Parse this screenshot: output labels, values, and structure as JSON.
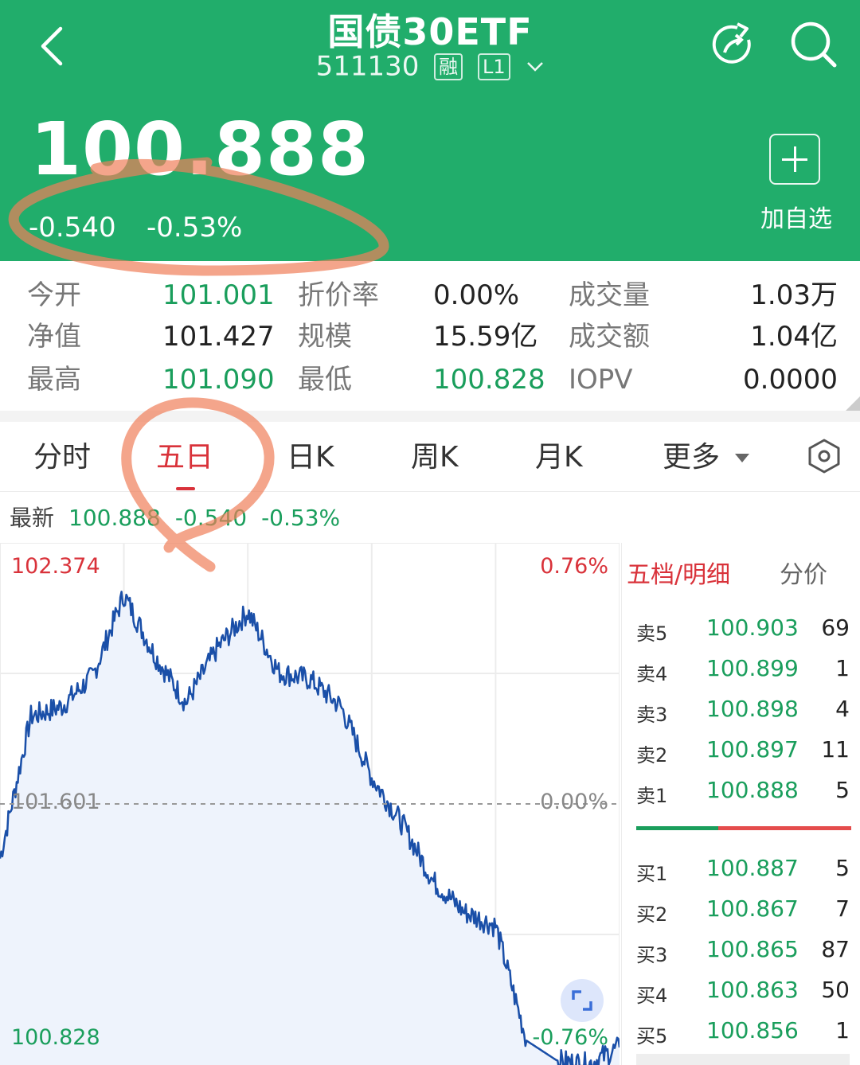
{
  "header": {
    "title": "国债30ETF",
    "code": "511130",
    "tag_margin": "融",
    "tag_level": "L1",
    "price": "100.888",
    "change": "-0.540",
    "change_pct": "-0.53%",
    "add_label": "加自选",
    "bg_color": "#21ad6b"
  },
  "stats": [
    {
      "label": "今开",
      "value": "101.001",
      "color": "green"
    },
    {
      "label": "折价率",
      "value": "0.00%",
      "color": "dark"
    },
    {
      "label": "成交量",
      "value": "1.03万",
      "color": "dark"
    },
    {
      "label": "净值",
      "value": "101.427",
      "color": "dark"
    },
    {
      "label": "规模",
      "value": "15.59亿",
      "color": "dark"
    },
    {
      "label": "成交额",
      "value": "1.04亿",
      "color": "dark"
    },
    {
      "label": "最高",
      "value": "101.090",
      "color": "green"
    },
    {
      "label": "最低",
      "value": "100.828",
      "color": "green"
    },
    {
      "label": "IOPV",
      "value": "0.0000",
      "color": "dark"
    }
  ],
  "tabs": [
    {
      "label": "分时",
      "active": false
    },
    {
      "label": "五日",
      "active": true
    },
    {
      "label": "日K",
      "active": false
    },
    {
      "label": "周K",
      "active": false
    },
    {
      "label": "月K",
      "active": false
    },
    {
      "label": "更多",
      "active": false
    }
  ],
  "latest": {
    "label": "最新",
    "price": "100.888",
    "change": "-0.540",
    "change_pct": "-0.53%"
  },
  "chart_data": {
    "type": "line",
    "y_top_label": "102.374",
    "y_mid_label": "101.601",
    "y_bottom_label": "100.828",
    "pct_top_label": "0.76%",
    "pct_mid_label": "0.00%",
    "pct_bottom_label": "-0.76%",
    "ylim": [
      100.828,
      102.374
    ],
    "reference": 101.601,
    "grid": true,
    "line_color": "#1a4fa8",
    "fill_color": "#eef3fc",
    "x": [
      0,
      0.25,
      0.5,
      0.75,
      1,
      1.25,
      1.5,
      1.75,
      2,
      2.25,
      2.5,
      2.75,
      3,
      3.25,
      3.5,
      3.75,
      4,
      4.25,
      4.5,
      4.75,
      5
    ],
    "values": [
      101.44,
      101.86,
      101.89,
      101.98,
      102.22,
      102.04,
      101.9,
      102.06,
      102.17,
      101.99,
      101.97,
      101.89,
      101.68,
      101.54,
      101.37,
      101.28,
      101.24,
      100.9,
      100.84,
      100.83,
      100.88
    ]
  },
  "book": {
    "tab1": "五档/明细",
    "tab2": "分价",
    "rows": [
      {
        "side": "卖5",
        "price": "100.903",
        "vol": "69"
      },
      {
        "side": "卖4",
        "price": "100.899",
        "vol": "1"
      },
      {
        "side": "卖3",
        "price": "100.898",
        "vol": "4"
      },
      {
        "side": "卖2",
        "price": "100.897",
        "vol": "11"
      },
      {
        "side": "卖1",
        "price": "100.888",
        "vol": "5"
      },
      {
        "side": "买1",
        "price": "100.887",
        "vol": "5"
      },
      {
        "side": "买2",
        "price": "100.867",
        "vol": "7"
      },
      {
        "side": "买3",
        "price": "100.865",
        "vol": "87"
      },
      {
        "side": "买4",
        "price": "100.863",
        "vol": "50"
      },
      {
        "side": "买5",
        "price": "100.856",
        "vol": "1"
      }
    ],
    "bid_ratio": 0.38
  },
  "colors": {
    "up": "#d9323a",
    "down": "#1a9e5c",
    "annotation": "#f07f5a"
  }
}
